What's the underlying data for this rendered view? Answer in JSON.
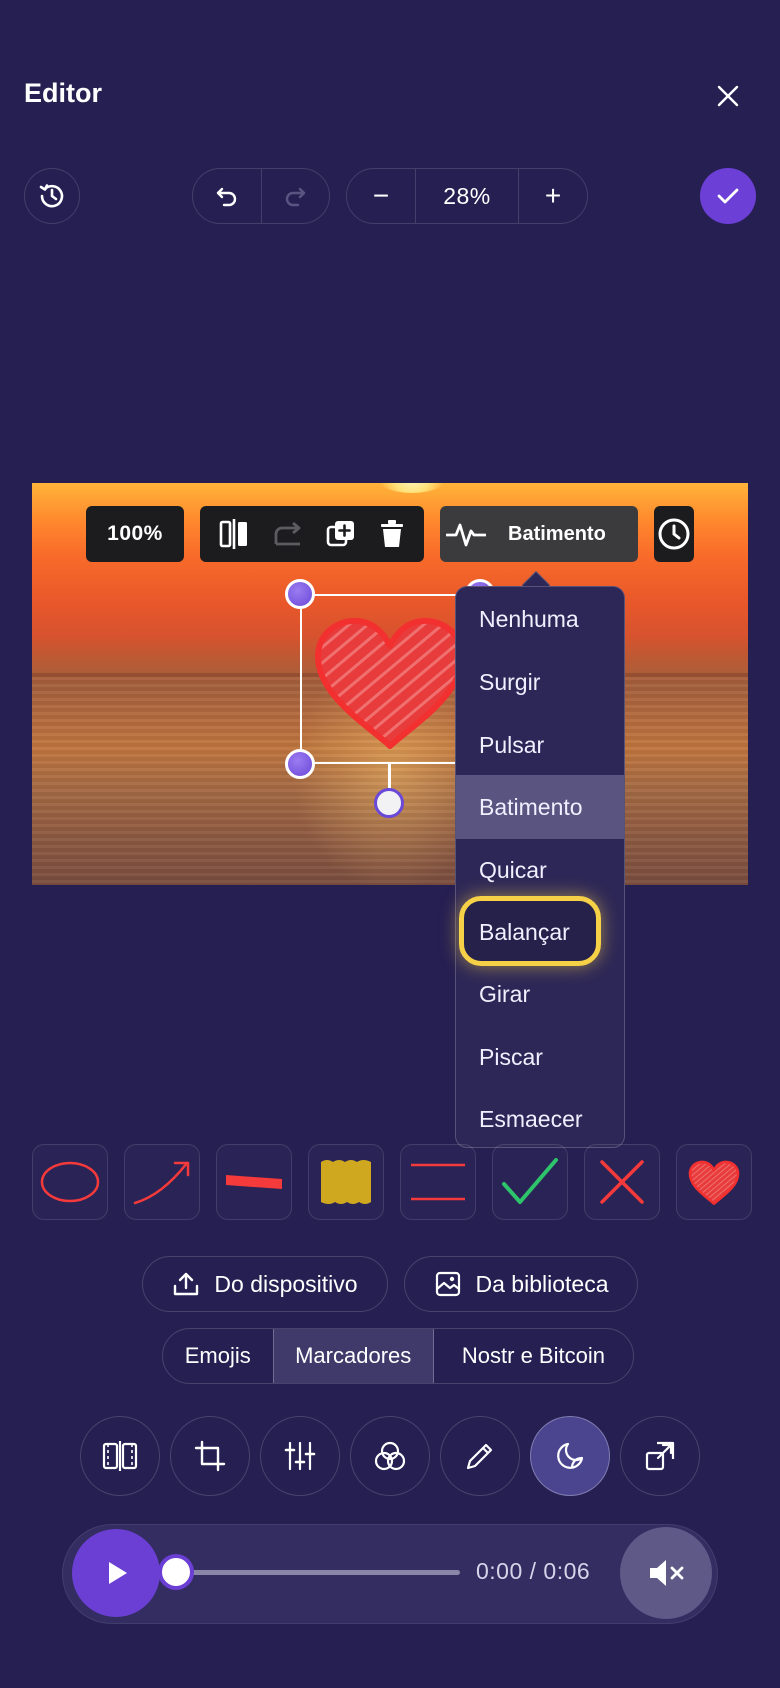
{
  "header": {
    "title": "Editor"
  },
  "toolbar": {
    "zoom_value": "28%",
    "zoom_out_label": "−",
    "zoom_in_label": "+"
  },
  "object_toolbar": {
    "scale": "100%",
    "animation_label": "Batimento"
  },
  "animation_menu": {
    "items": [
      "Nenhuma",
      "Surgir",
      "Pulsar",
      "Batimento",
      "Quicar",
      "Balançar",
      "Girar",
      "Piscar",
      "Esmaecer"
    ],
    "selected": "Batimento",
    "highlighted": "Balançar"
  },
  "stickers": [
    "ellipse-outline",
    "arrow",
    "brush-stroke",
    "highlight-block",
    "double-line",
    "checkmark",
    "cross",
    "heart"
  ],
  "sources": {
    "device": "Do dispositivo",
    "library": "Da biblioteca"
  },
  "tabs": [
    "Emojis",
    "Marcadores",
    "Nostr e Bitcoin"
  ],
  "tabs_active": "Marcadores",
  "tools": [
    "trim-icon",
    "crop-icon",
    "adjust-icon",
    "filters-icon",
    "draw-icon",
    "sticker-icon",
    "resize-icon"
  ],
  "player": {
    "time": "0:00 / 0:06",
    "progress": 0.0
  },
  "colors": {
    "background": "#261f52",
    "accent": "#6b3fd4",
    "highlight": "#f6d047",
    "sticker_red": "#f43a3a",
    "check_green": "#2ec46b"
  }
}
